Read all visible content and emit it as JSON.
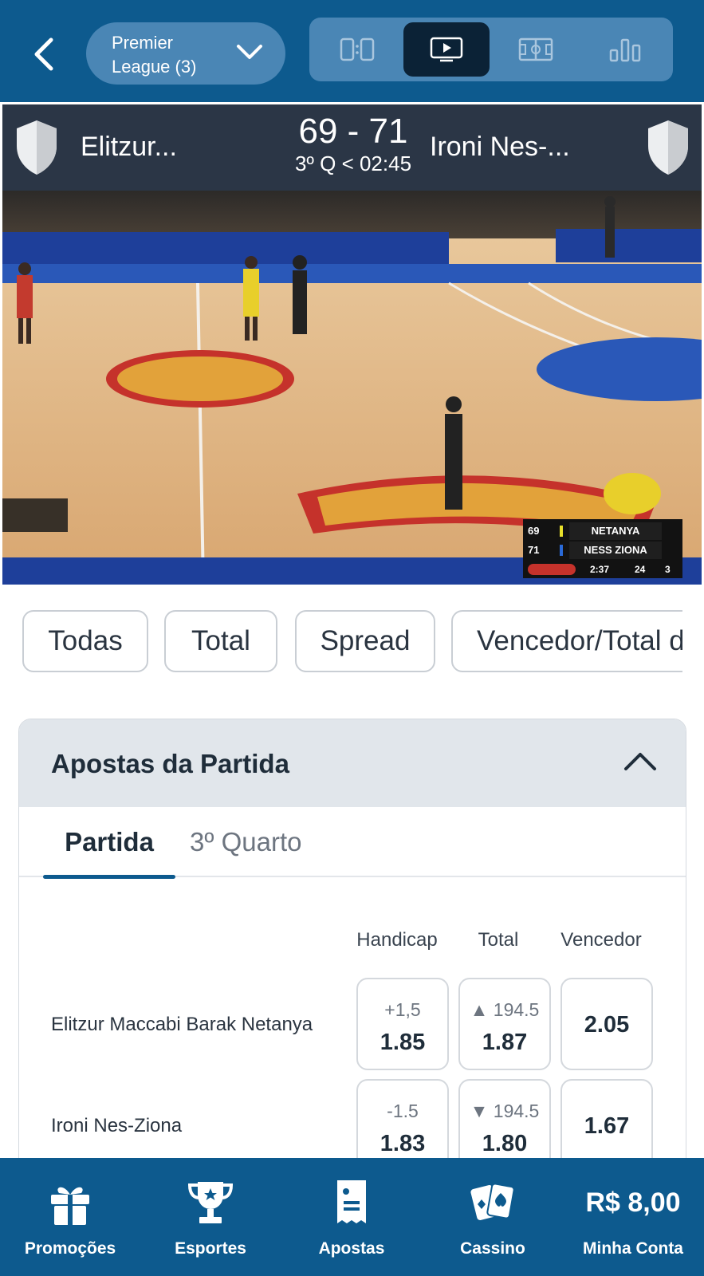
{
  "header": {
    "league_label": "Premier League (3)",
    "view_tabs": [
      {
        "icon": "scoreboard-icon"
      },
      {
        "icon": "live-stream-icon",
        "active": true
      },
      {
        "icon": "court-icon"
      },
      {
        "icon": "stats-icon"
      }
    ]
  },
  "scoreboard": {
    "home_team": "Elitzur...",
    "away_team": "Ironi Nes-...",
    "score": "69 - 71",
    "clock": "3º Q < 02:45"
  },
  "video": {
    "overlay": {
      "home_score": "69",
      "away_score": "71",
      "home_team": "NETANYA",
      "away_team": "NESS ZIONA",
      "game_clock": "2:37",
      "shot_clock": "24",
      "quarter": "3"
    }
  },
  "filters": [
    "Todas",
    "Total",
    "Spread",
    "Vencedor/Total de"
  ],
  "market": {
    "title": "Apostas da Partida",
    "tabs": [
      "Partida",
      "3º Quarto"
    ],
    "columns": [
      "Handicap",
      "Total",
      "Vencedor"
    ],
    "rows": [
      {
        "team": "Elitzur Maccabi Barak Netanya",
        "handicap_line": "+1,5",
        "handicap_price": "1.85",
        "total_line": "▲ 194.5",
        "total_price": "1.87",
        "winner_price": "2.05"
      },
      {
        "team": "Ironi Nes-Ziona",
        "handicap_line": "-1.5",
        "handicap_price": "1.83",
        "total_line": "▼ 194.5",
        "total_price": "1.80",
        "winner_price": "1.67"
      }
    ]
  },
  "bottom_nav": {
    "items": [
      {
        "label": "Promoções",
        "icon": "gift-icon"
      },
      {
        "label": "Esportes",
        "icon": "trophy-icon"
      },
      {
        "label": "Apostas",
        "icon": "ticket-icon"
      },
      {
        "label": "Cassino",
        "icon": "cards-icon"
      }
    ],
    "account": {
      "balance": "R$ 8,00",
      "label": "Minha Conta"
    }
  },
  "colors": {
    "brand_blue": "#0d5a8e",
    "pill_blue": "#4a86b5",
    "scoreboard_bg": "#2b3646",
    "card_header_bg": "#e1e6eb"
  }
}
